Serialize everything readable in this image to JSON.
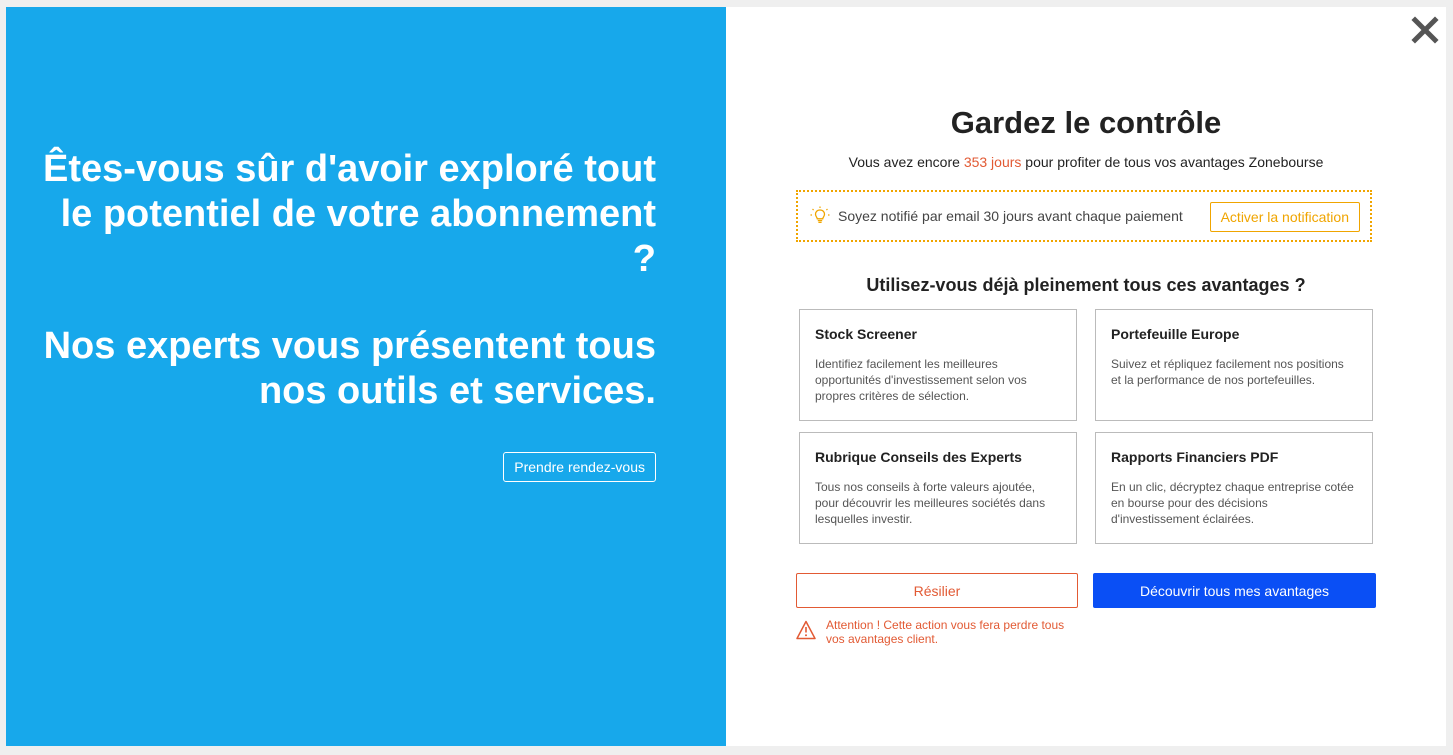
{
  "left_panel": {
    "headline": "Êtes-vous sûr d'avoir exploré tout le potentiel de votre abonnement ?",
    "subheadline": "Nos experts vous présentent tous nos outils et services.",
    "appointment_label": "Prendre rendez-vous",
    "background": "#17a8eb"
  },
  "right_panel": {
    "title": "Gardez le contrôle",
    "subtitle_prefix": "Vous avez encore ",
    "subtitle_days": "353 jours",
    "subtitle_suffix": " pour profiter de tous vos avantages Zonebourse",
    "notification": {
      "text": "Soyez notifié par email 30 jours avant chaque paiement",
      "button_label": "Activer la notification",
      "icon": "lightbulb-icon"
    },
    "question": "Utilisez-vous déjà pleinement tous ces avantages ?",
    "cards": [
      {
        "title": "Stock Screener",
        "description": "Identifiez facilement les meilleures opportunités d'investissement selon vos propres critères de sélection."
      },
      {
        "title": "Portefeuille Europe",
        "description": "Suivez et répliquez facilement nos positions et la performance de nos portefeuilles."
      },
      {
        "title": "Rubrique Conseils des Experts",
        "description": "Tous nos conseils à forte valeurs ajoutée, pour découvrir les meilleures sociétés dans lesquelles investir."
      },
      {
        "title": "Rapports Financiers PDF",
        "description": "En un clic, décryptez chaque entreprise cotée en bourse pour des décisions d'investissement éclairées."
      }
    ],
    "cancel_label": "Résilier",
    "discover_label": "Découvrir tous mes avantages",
    "warning_text": "Attention ! Cette action vous fera perdre tous vos avantages client.",
    "close_icon": "close-icon"
  },
  "colors": {
    "accent_orange": "#f0a500",
    "danger": "#e25a34",
    "primary_blue": "#0a4ff5"
  }
}
